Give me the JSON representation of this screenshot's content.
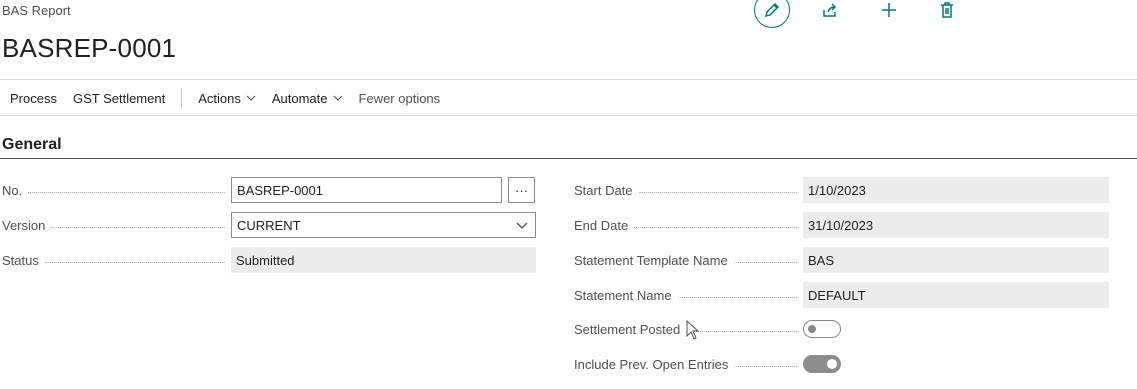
{
  "header": {
    "caption": "BAS Report",
    "title": "BASREP-0001",
    "icons": [
      "edit-icon",
      "share-icon",
      "new-icon",
      "delete-icon"
    ]
  },
  "actionbar": {
    "items": [
      {
        "label": "Process"
      },
      {
        "label": "GST Settlement"
      },
      {
        "label": "Actions"
      },
      {
        "label": "Automate"
      },
      {
        "label": "Fewer options"
      }
    ]
  },
  "general": {
    "section_title": "General",
    "left": {
      "no": {
        "label": "No.",
        "value": "BASREP-0001",
        "assist": "···"
      },
      "version": {
        "label": "Version",
        "value": "CURRENT"
      },
      "status": {
        "label": "Status",
        "value": "Submitted"
      }
    },
    "right": {
      "start_date": {
        "label": "Start Date",
        "value": "1/10/2023"
      },
      "end_date": {
        "label": "End Date",
        "value": "31/10/2023"
      },
      "statement_template_name": {
        "label": "Statement Template Name",
        "value": "BAS"
      },
      "statement_name": {
        "label": "Statement Name",
        "value": "DEFAULT"
      },
      "settlement_posted": {
        "label": "Settlement Posted",
        "value": false
      },
      "include_prev_open_entries": {
        "label": "Include Prev. Open Entries",
        "value": true
      }
    }
  },
  "colors": {
    "accent": "#00797a",
    "readonly_bg": "#ececec",
    "label": "#505050"
  }
}
